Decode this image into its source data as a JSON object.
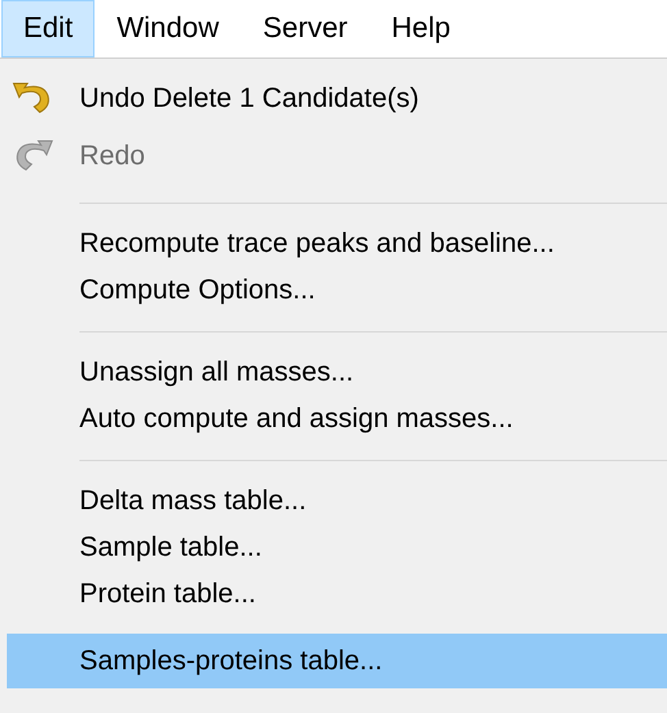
{
  "menubar": [
    {
      "label": "Edit",
      "selected": true
    },
    {
      "label": "Window",
      "selected": false
    },
    {
      "label": "Server",
      "selected": false
    },
    {
      "label": "Help",
      "selected": false
    }
  ],
  "menu": [
    {
      "kind": "undo",
      "label": "Undo Delete 1 Candidate(s)",
      "disabled": false,
      "selected": false
    },
    {
      "kind": "redo",
      "label": "Redo",
      "disabled": true,
      "selected": false
    },
    {
      "kind": "separator"
    },
    {
      "kind": "item",
      "label": "Recompute trace peaks and baseline...",
      "disabled": false,
      "selected": false
    },
    {
      "kind": "item",
      "label": "Compute Options...",
      "disabled": false,
      "selected": false
    },
    {
      "kind": "separator"
    },
    {
      "kind": "item",
      "label": "Unassign all masses...",
      "disabled": false,
      "selected": false
    },
    {
      "kind": "item",
      "label": "Auto compute and assign masses...",
      "disabled": false,
      "selected": false
    },
    {
      "kind": "separator"
    },
    {
      "kind": "item",
      "label": "Delta mass table...",
      "disabled": false,
      "selected": false
    },
    {
      "kind": "item",
      "label": "Sample table...",
      "disabled": false,
      "selected": false
    },
    {
      "kind": "item",
      "label": "Protein table...",
      "disabled": false,
      "selected": false
    },
    {
      "kind": "item",
      "label": "Samples-proteins table...",
      "disabled": false,
      "selected": true
    }
  ]
}
